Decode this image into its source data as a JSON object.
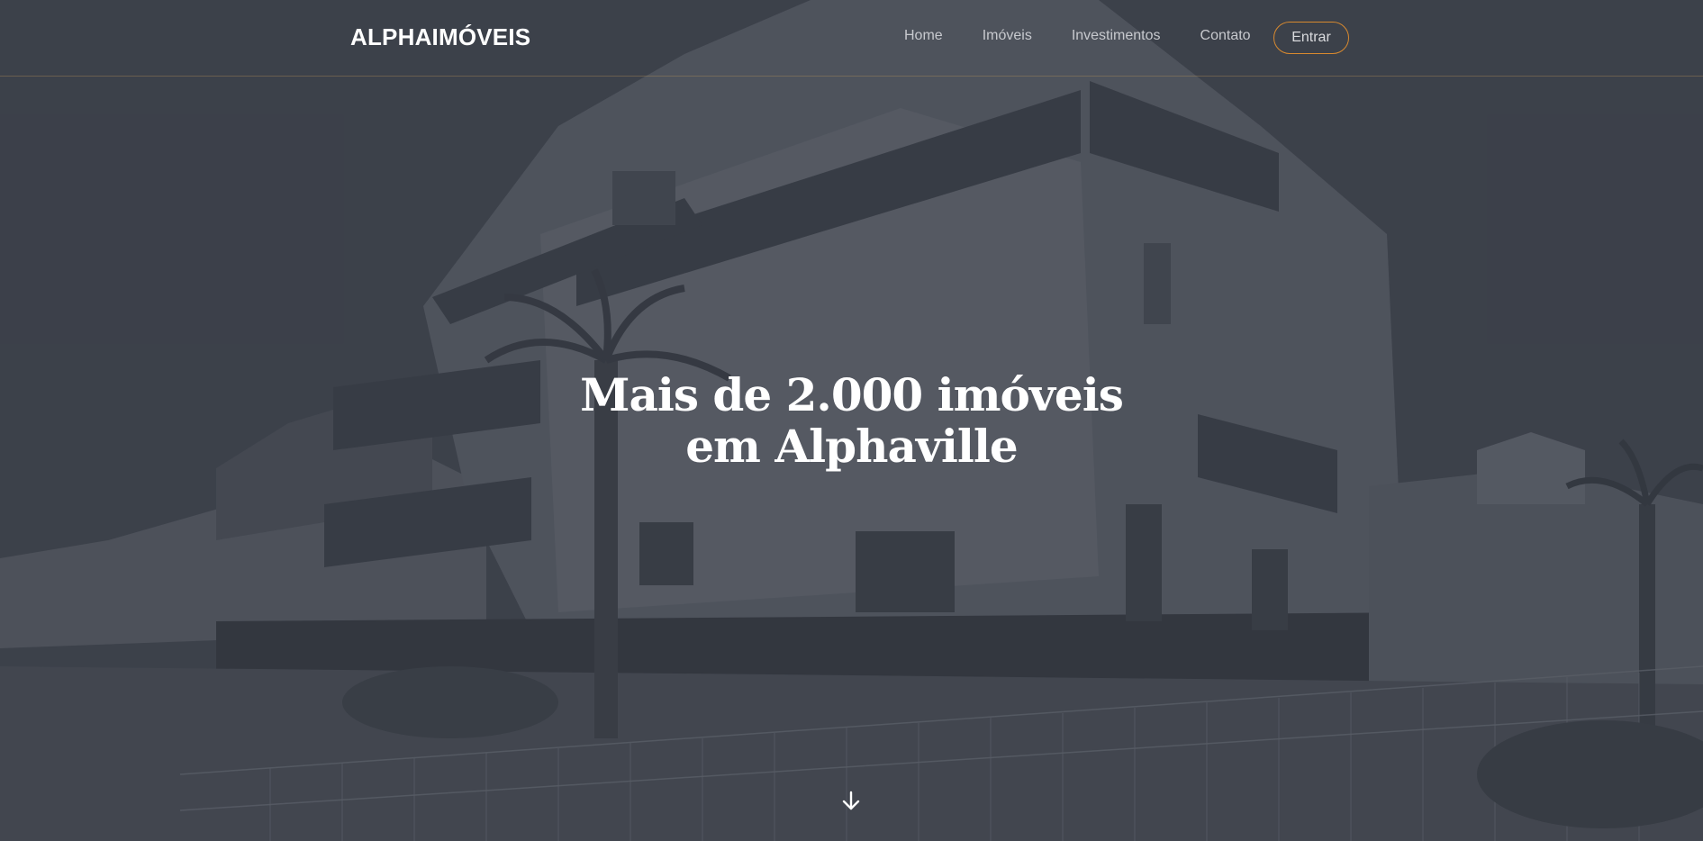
{
  "brand": {
    "logo_text": "ALPHAIMÓVEIS"
  },
  "nav": {
    "items": [
      {
        "label": "Home"
      },
      {
        "label": "Imóveis"
      },
      {
        "label": "Investimentos"
      },
      {
        "label": "Contato"
      }
    ],
    "login_label": "Entrar",
    "login_border_color": "#d8892f"
  },
  "hero": {
    "headline_line1": "Mais de 2.000 imóveis",
    "headline_line2": "em Alphaville",
    "scroll_icon": "arrow-down-icon",
    "background_image": "apartment-building-photo"
  },
  "colors": {
    "overlay": "#3a3e48",
    "text": "#ffffff",
    "nav_text": "#c7c9ce",
    "accent": "#d8892f"
  }
}
